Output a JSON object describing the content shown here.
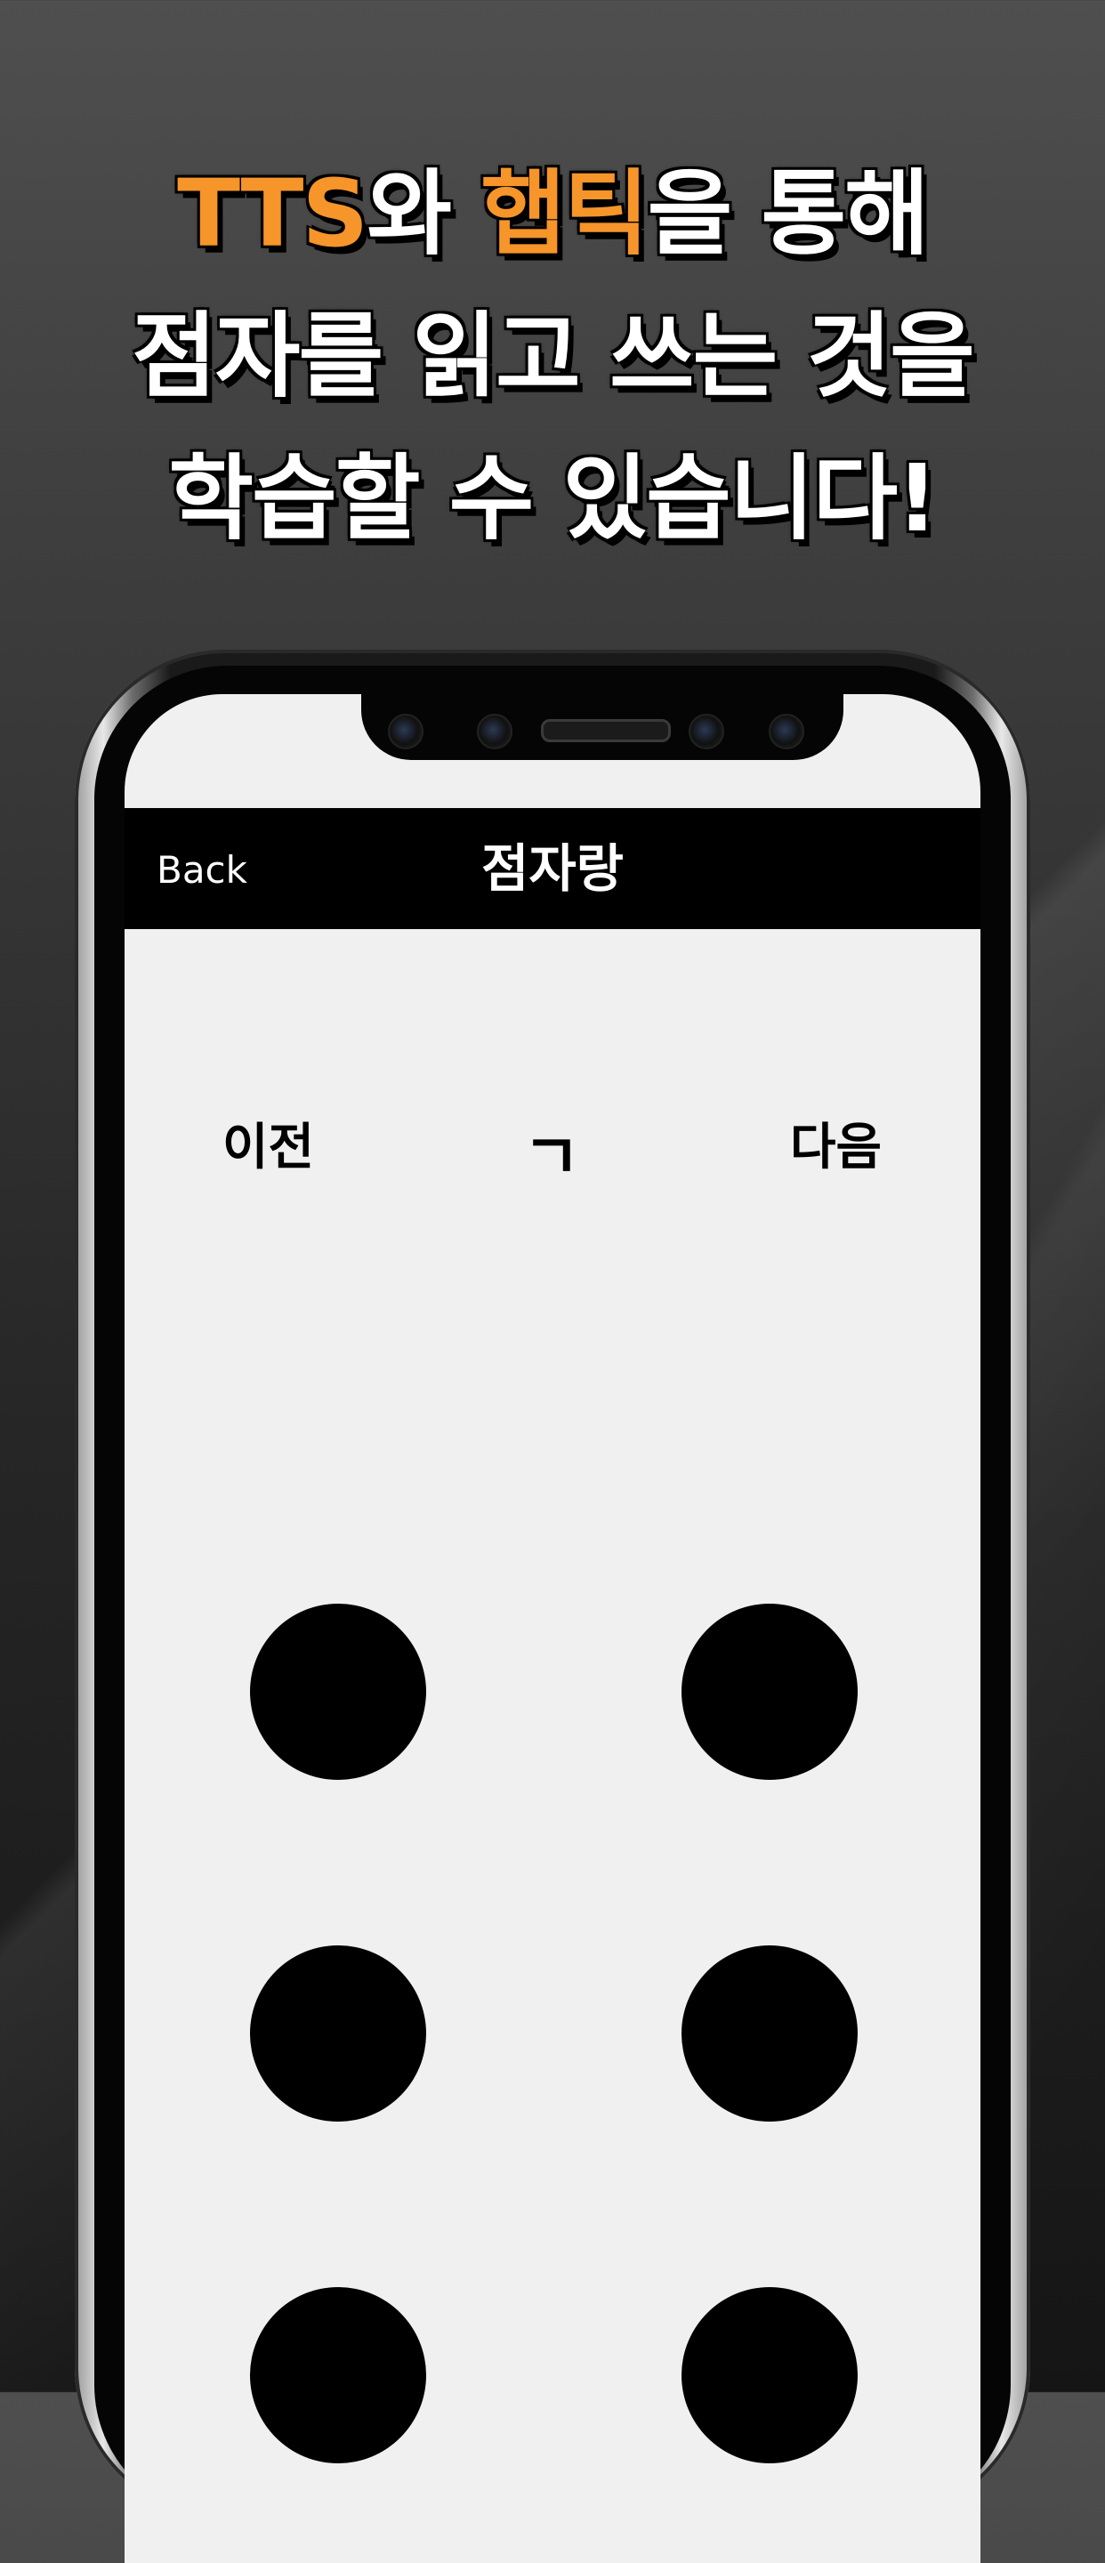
{
  "headline": {
    "line1_part1": "TTS",
    "line1_part2": "와 ",
    "line1_part3": "햅틱",
    "line1_part4": "을 통해",
    "line2": "점자를 읽고 쓰는 것을",
    "line3": "학습할 수 있습니다!"
  },
  "colors": {
    "accent": "#f6952a",
    "nav_background": "#000000",
    "screen_background": "#f0f0f0",
    "dot_fill": "#000000"
  },
  "navbar": {
    "back_label": "Back",
    "title": "점자랑"
  },
  "controls": {
    "prev_label": "이전",
    "current_letter": "ㄱ",
    "next_label": "다음"
  },
  "braille_cell": {
    "dots": [
      {
        "id": 1,
        "raised": true
      },
      {
        "id": 2,
        "raised": true
      },
      {
        "id": 3,
        "raised": true
      },
      {
        "id": 4,
        "raised": true
      },
      {
        "id": 5,
        "raised": true
      },
      {
        "id": 6,
        "raised": true
      }
    ]
  }
}
